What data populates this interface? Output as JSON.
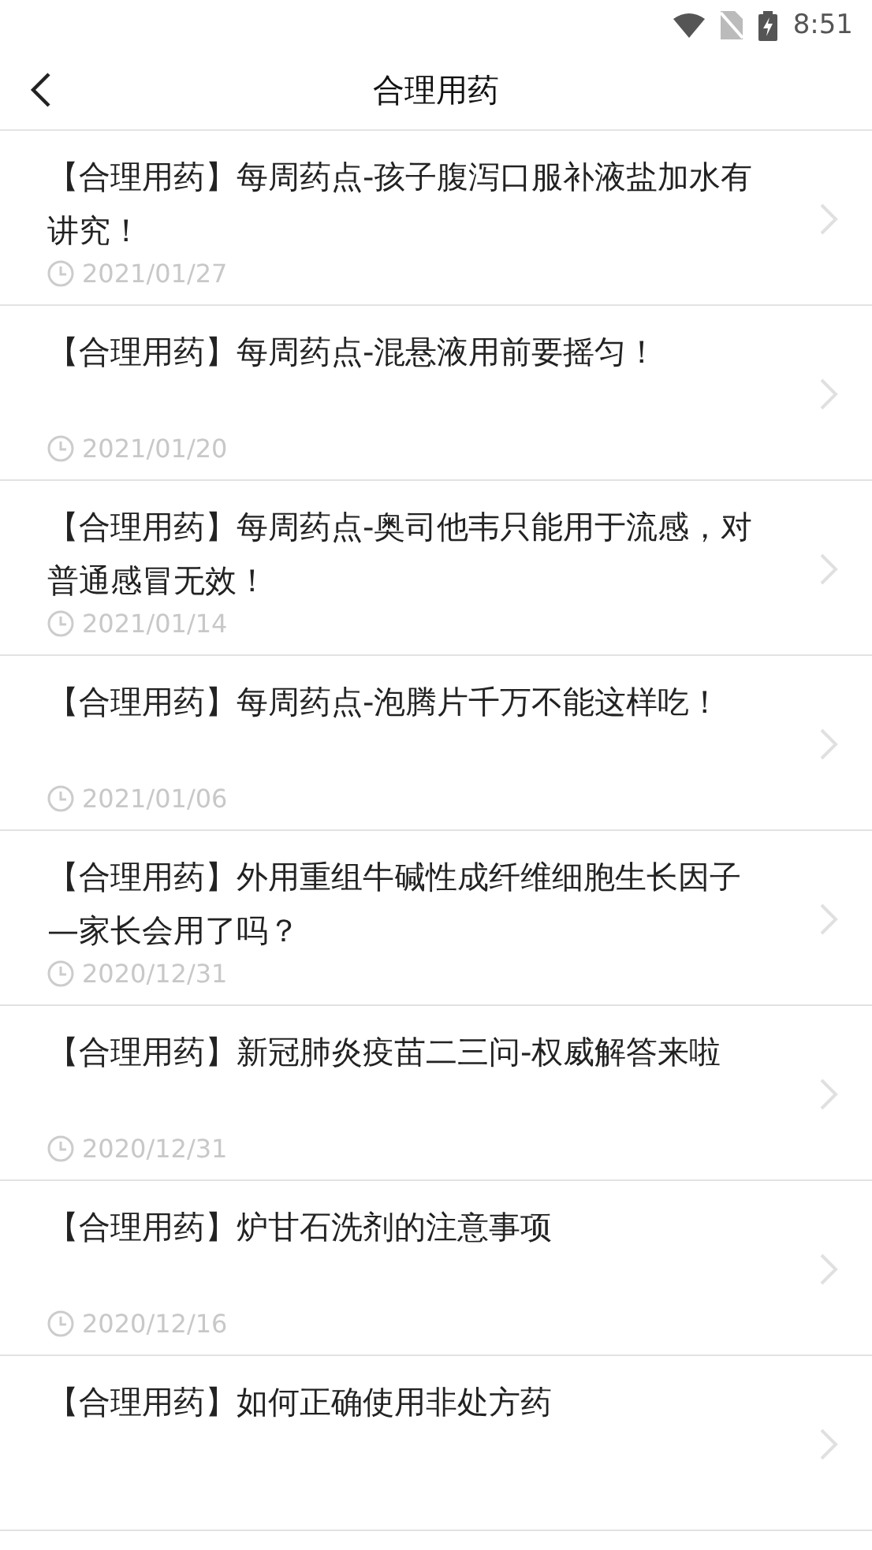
{
  "status_bar": {
    "time": "8:51"
  },
  "header": {
    "title": "合理用药"
  },
  "articles": [
    {
      "title": "【合理用药】每周药点-孩子腹泻口服补液盐加水有讲究！",
      "date": "2021/01/27"
    },
    {
      "title": "【合理用药】每周药点-混悬液用前要摇匀！",
      "date": "2021/01/20"
    },
    {
      "title": "【合理用药】每周药点-奥司他韦只能用于流感，对普通感冒无效！",
      "date": "2021/01/14"
    },
    {
      "title": "【合理用药】每周药点-泡腾片千万不能这样吃！",
      "date": "2021/01/06"
    },
    {
      "title": "【合理用药】外用重组牛碱性成纤维细胞生长因子—家长会用了吗？",
      "date": "2020/12/31"
    },
    {
      "title": "【合理用药】新冠肺炎疫苗二三问-权威解答来啦",
      "date": "2020/12/31"
    },
    {
      "title": "【合理用药】炉甘石洗剂的注意事项",
      "date": "2020/12/16"
    },
    {
      "title": "【合理用药】如何正确使用非处方药"
    }
  ]
}
